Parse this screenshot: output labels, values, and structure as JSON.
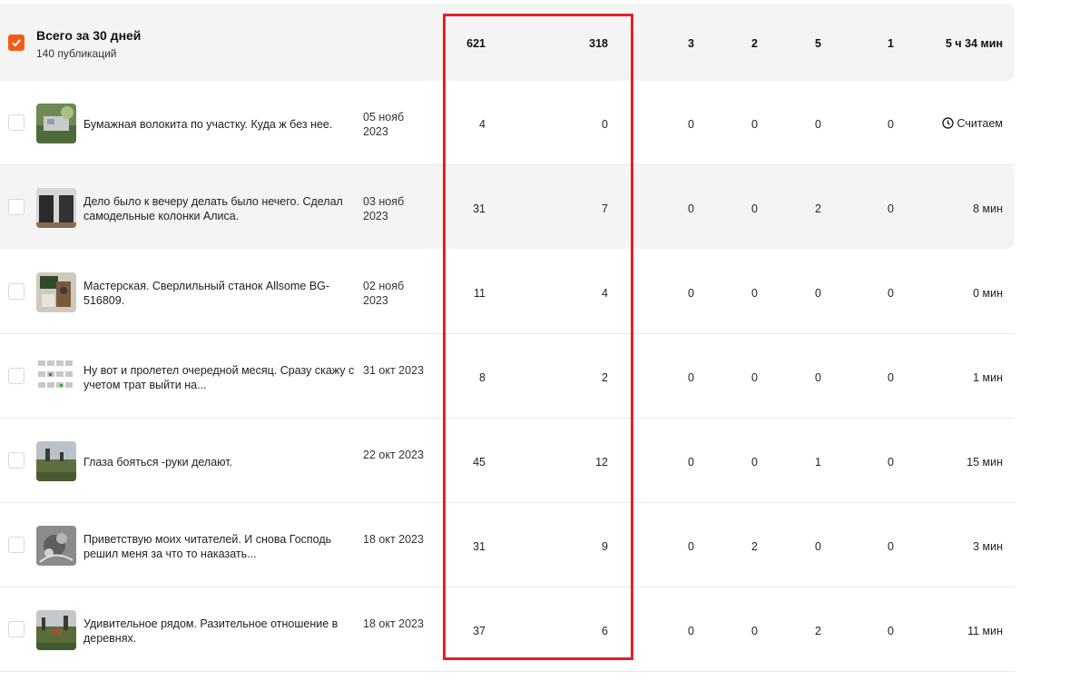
{
  "summary": {
    "title": "Всего за 30 дней",
    "subtitle": "140 публикаций",
    "values": [
      "621",
      "318",
      "3",
      "2",
      "5",
      "1",
      "5 ч 34 мин"
    ]
  },
  "rows": [
    {
      "title": "Бумажная волокита по участку. Куда ж без нее.",
      "date": "05 нояб 2023",
      "values": [
        "4",
        "0",
        "0",
        "0",
        "0",
        "0",
        "Считаем"
      ],
      "thumb": "garden-photo"
    },
    {
      "title": "Дело было к вечеру делать было нечего. Сделал самодельные колонки Алиса.",
      "date": "03 нояб 2023",
      "values": [
        "31",
        "7",
        "0",
        "0",
        "2",
        "0",
        "8 мин"
      ],
      "thumb": "speakers-photo"
    },
    {
      "title": "Мастерская. Сверлильный станок Allsome BG-516809.",
      "date": "02 нояб 2023",
      "values": [
        "11",
        "4",
        "0",
        "0",
        "0",
        "0",
        "0 мин"
      ],
      "thumb": "workshop-photo"
    },
    {
      "title": "Ну вот и пролетел очередной месяц. Сразу скажу с учетом трат выйти на...",
      "date": "31 окт 2023",
      "values": [
        "8",
        "2",
        "0",
        "0",
        "0",
        "0",
        "1 мин"
      ],
      "thumb": "calendar-photo"
    },
    {
      "title": "Глаза бояться -руки делают.",
      "date": "22 окт 2023",
      "values": [
        "45",
        "12",
        "0",
        "0",
        "1",
        "0",
        "15 мин"
      ],
      "thumb": "field-photo"
    },
    {
      "title": "Приветствую моих читателей. И снова Господь решил меня за что то наказать...",
      "date": "18 окт 2023",
      "values": [
        "31",
        "9",
        "0",
        "2",
        "0",
        "0",
        "3 мин"
      ],
      "thumb": "xray-photo"
    },
    {
      "title": "Удивительное рядом. Разительное отношение в деревнях.",
      "date": "18 окт 2023",
      "values": [
        "37",
        "6",
        "0",
        "0",
        "2",
        "0",
        "11 мин"
      ],
      "thumb": "village-photo"
    }
  ],
  "colors": {
    "accent": "#f25c19",
    "highlight_box": "#e4202a",
    "row_shade": "#f4f4f4"
  }
}
